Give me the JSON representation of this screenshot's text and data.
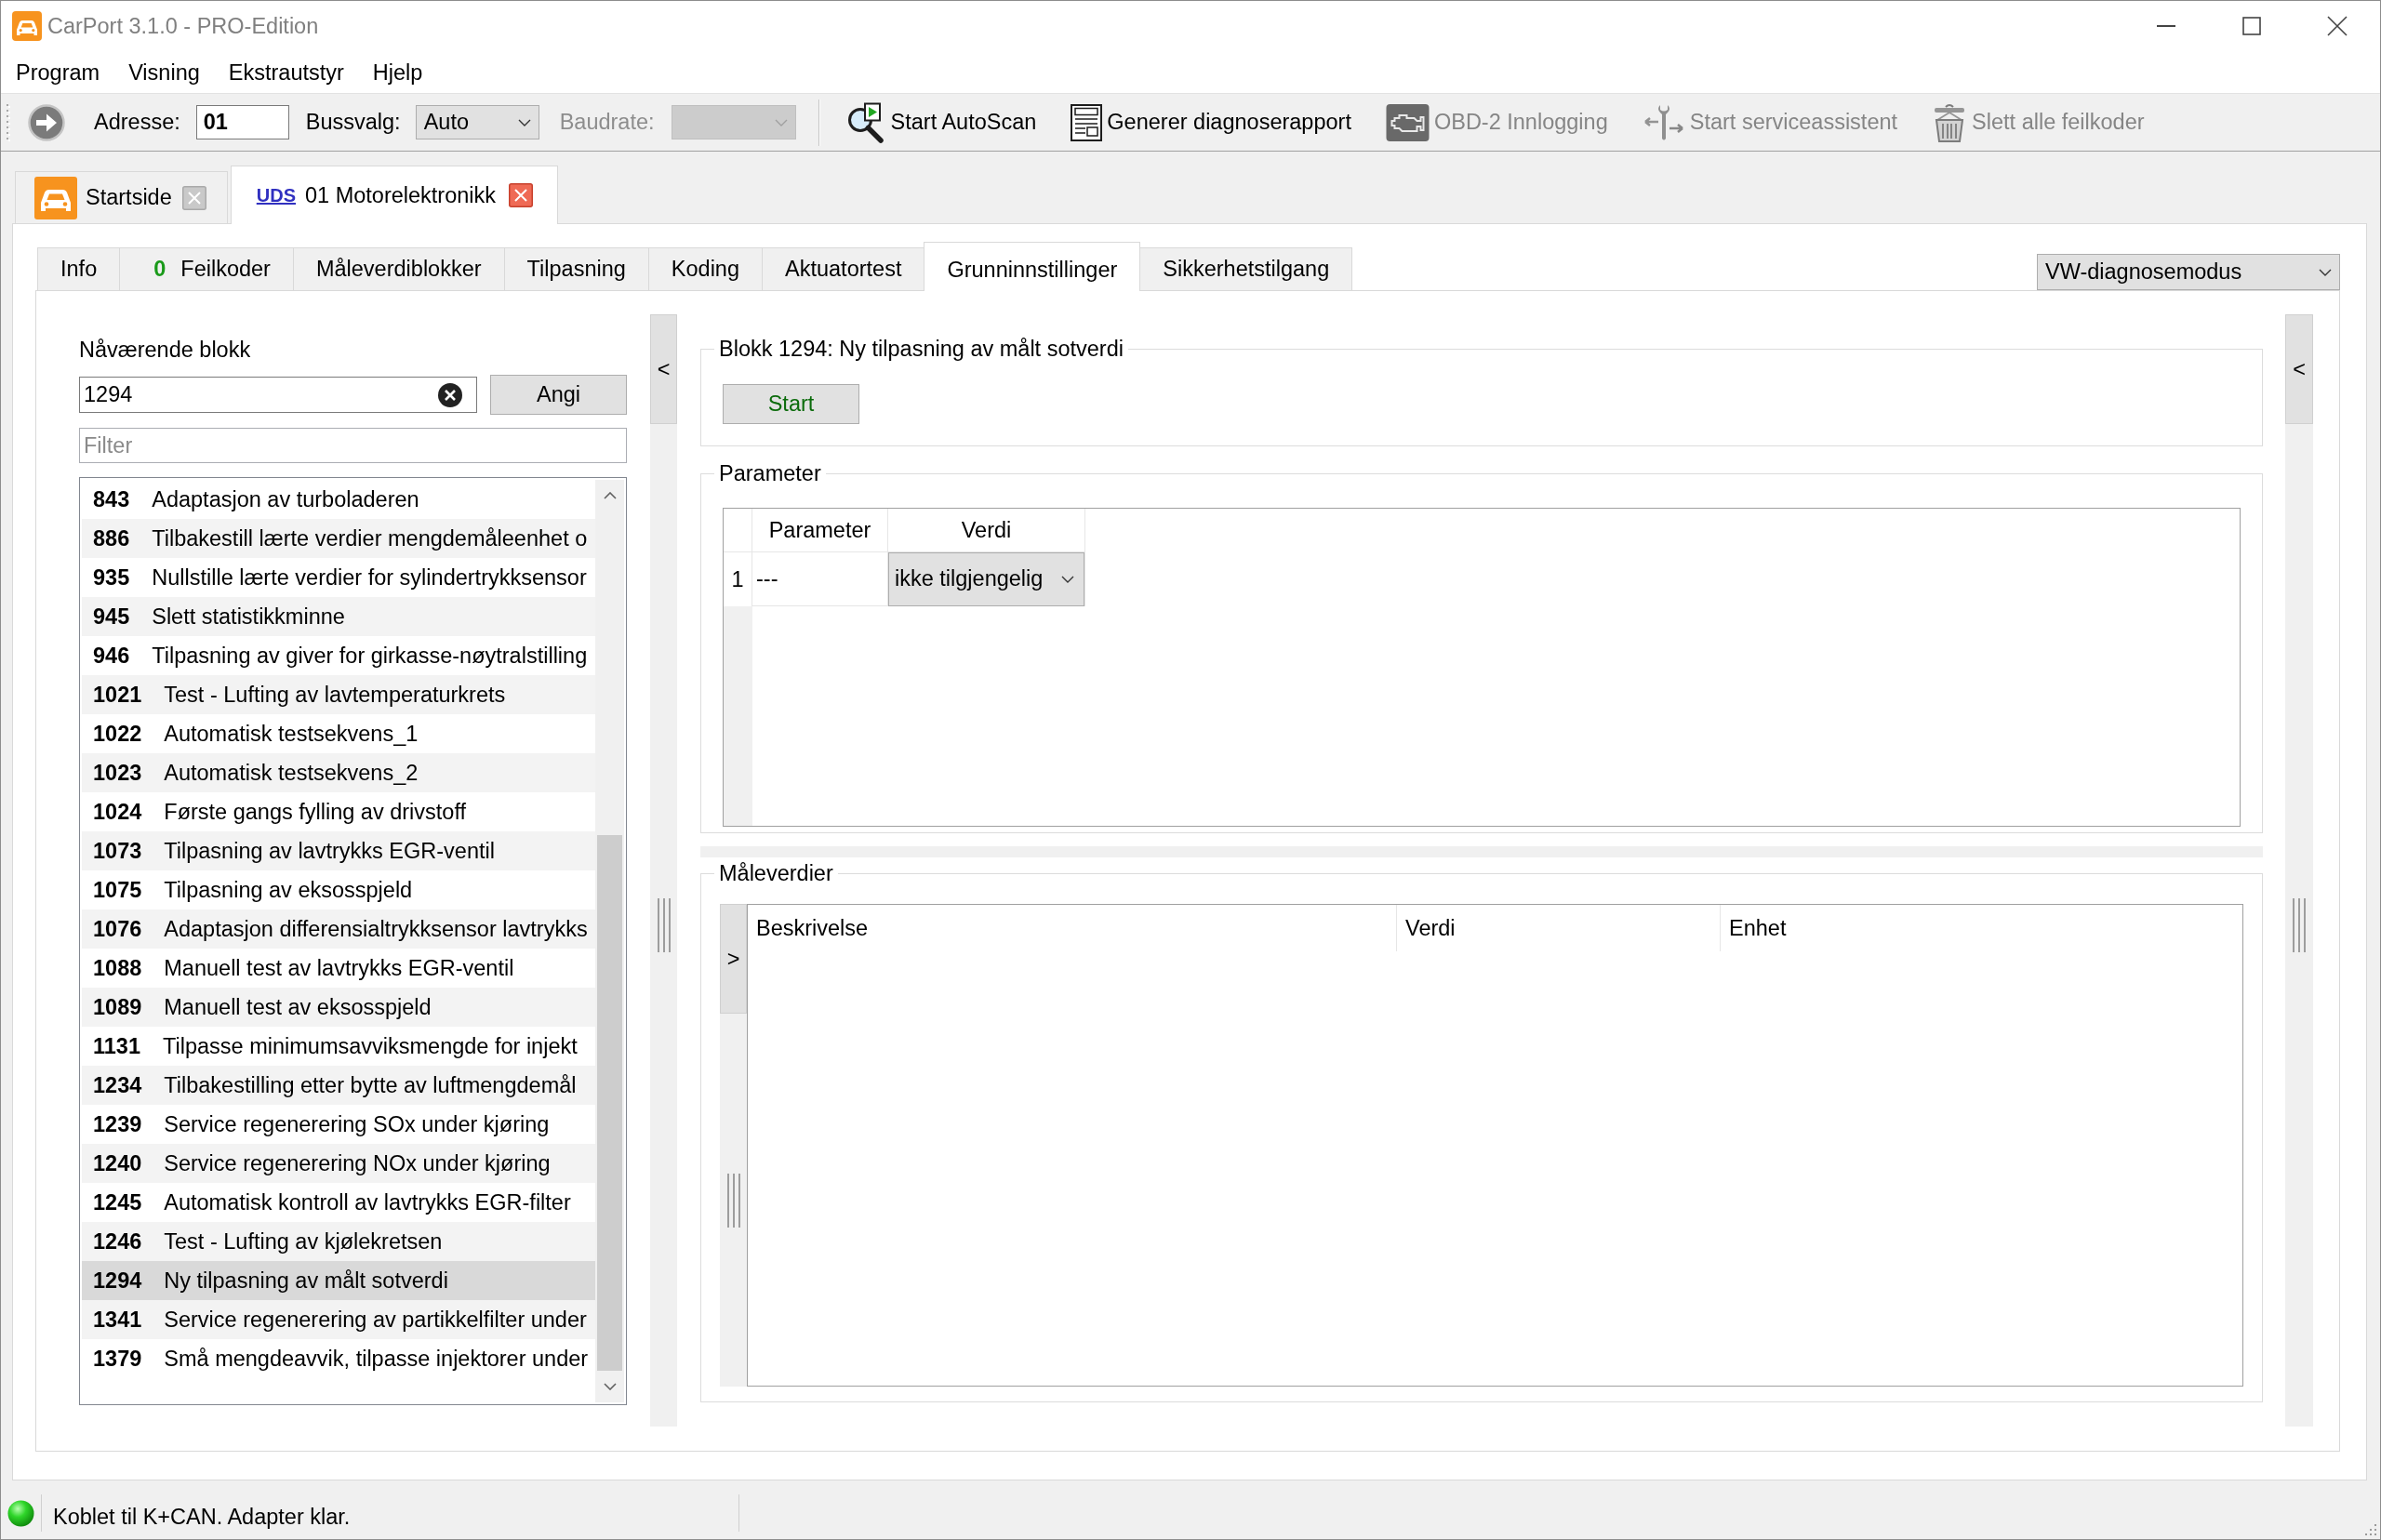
{
  "window": {
    "title": "CarPort 3.1.0 - PRO-Edition"
  },
  "menu": [
    "Program",
    "Visning",
    "Ekstrautstyr",
    "Hjelp"
  ],
  "toolbar": {
    "address": {
      "label": "Adresse:",
      "value": "01"
    },
    "bus": {
      "label": "Bussvalg:",
      "value": "Auto"
    },
    "baudrate": {
      "label": "Baudrate:",
      "disabled": true
    },
    "actions": [
      {
        "kind": "autoscan",
        "label": "Start AutoScan",
        "disabled": false
      },
      {
        "kind": "report",
        "label": "Generer diagnoserapport",
        "disabled": false
      },
      {
        "kind": "obd",
        "label": "OBD-2 Innlogging",
        "disabled": true
      },
      {
        "kind": "service",
        "label": "Start serviceassistent",
        "disabled": true
      },
      {
        "kind": "erase",
        "label": "Slett alle feilkoder",
        "disabled": true
      }
    ]
  },
  "document_tabs": [
    {
      "kind": "home",
      "label": "Startside",
      "selected": false
    },
    {
      "kind": "module",
      "protocol": "UDS",
      "label": "01 Motorelektronikk",
      "selected": true
    }
  ],
  "tabs": [
    {
      "label": "Info",
      "selected": false
    },
    {
      "label": "Feilkoder",
      "count": "0",
      "selected": false
    },
    {
      "label": "Måleverdiblokker",
      "selected": false
    },
    {
      "label": "Tilpasning",
      "selected": false
    },
    {
      "label": "Koding",
      "selected": false
    },
    {
      "label": "Aktuatortest",
      "selected": false
    },
    {
      "label": "Grunninnstillinger",
      "selected": true
    },
    {
      "label": "Sikkerhetstilgang",
      "selected": false
    }
  ],
  "mode_select": {
    "value": "VW-diagnosemodus"
  },
  "block_selector": {
    "label": "Nåværende blokk",
    "input": {
      "value": "1294"
    },
    "button": "Angi",
    "filter": {
      "placeholder": "Filter"
    },
    "blocks": [
      {
        "number": "843",
        "name": "Adaptasjon av turboladeren",
        "selected": false
      },
      {
        "number": "886",
        "name": "Tilbakestill lærte verdier mengdemåleenhet o",
        "selected": false
      },
      {
        "number": "935",
        "name": "Nullstille lærte verdier for sylindertrykksensor",
        "selected": false
      },
      {
        "number": "945",
        "name": "Slett statistikkminne",
        "selected": false
      },
      {
        "number": "946",
        "name": "Tilpasning av giver for girkasse-nøytralstilling",
        "selected": false
      },
      {
        "number": "1021",
        "name": "Test - Lufting av lavtemperaturkrets",
        "selected": false
      },
      {
        "number": "1022",
        "name": "Automatisk testsekvens_1",
        "selected": false
      },
      {
        "number": "1023",
        "name": "Automatisk testsekvens_2",
        "selected": false
      },
      {
        "number": "1024",
        "name": "Første gangs fylling av drivstoff",
        "selected": false
      },
      {
        "number": "1073",
        "name": "Tilpasning av lavtrykks EGR-ventil",
        "selected": false
      },
      {
        "number": "1075",
        "name": "Tilpasning av eksosspjeld",
        "selected": false
      },
      {
        "number": "1076",
        "name": "Adaptasjon differensialtrykksensor lavtrykks",
        "selected": false
      },
      {
        "number": "1088",
        "name": "Manuell test av lavtrykks EGR-ventil",
        "selected": false
      },
      {
        "number": "1089",
        "name": "Manuell test av eksosspjeld",
        "selected": false
      },
      {
        "number": "1131",
        "name": "Tilpasse minimumsavviksmengde for injekt",
        "selected": false
      },
      {
        "number": "1234",
        "name": "Tilbakestilling etter bytte av luftmengdemål",
        "selected": false
      },
      {
        "number": "1239",
        "name": "Service regenerering SOx under kjøring",
        "selected": false
      },
      {
        "number": "1240",
        "name": "Service regenerering NOx under kjøring",
        "selected": false
      },
      {
        "number": "1245",
        "name": "Automatisk kontroll av lavtrykks EGR-filter",
        "selected": false
      },
      {
        "number": "1246",
        "name": "Test - Lufting av kjølekretsen",
        "selected": false
      },
      {
        "number": "1294",
        "name": "Ny tilpasning av målt sotverdi",
        "selected": true
      },
      {
        "number": "1341",
        "name": "Service regenerering av partikkelfilter under",
        "selected": false
      },
      {
        "number": "1379",
        "name": "Små mengdeavvik, tilpasse injektorer under",
        "selected": false
      }
    ]
  },
  "left_splitter": {
    "button": "<"
  },
  "block_group": {
    "title": "Blokk 1294: Ny tilpasning av målt sotverdi",
    "button": "Start"
  },
  "parameter_group": {
    "title": "Parameter",
    "columns": [
      "Parameter",
      "Verdi"
    ],
    "rows": [
      {
        "number": "1",
        "parameter": "---",
        "value": "ikke tilgjengelig"
      }
    ]
  },
  "measurement_group": {
    "title": "Måleverdier",
    "toggle": ">",
    "columns": [
      "Beskrivelse",
      "Verdi",
      "Enhet"
    ]
  },
  "right_splitter": {
    "button": "<"
  },
  "status_bar": {
    "connected": true,
    "text": "Koblet til K+CAN. Adapter klar."
  }
}
